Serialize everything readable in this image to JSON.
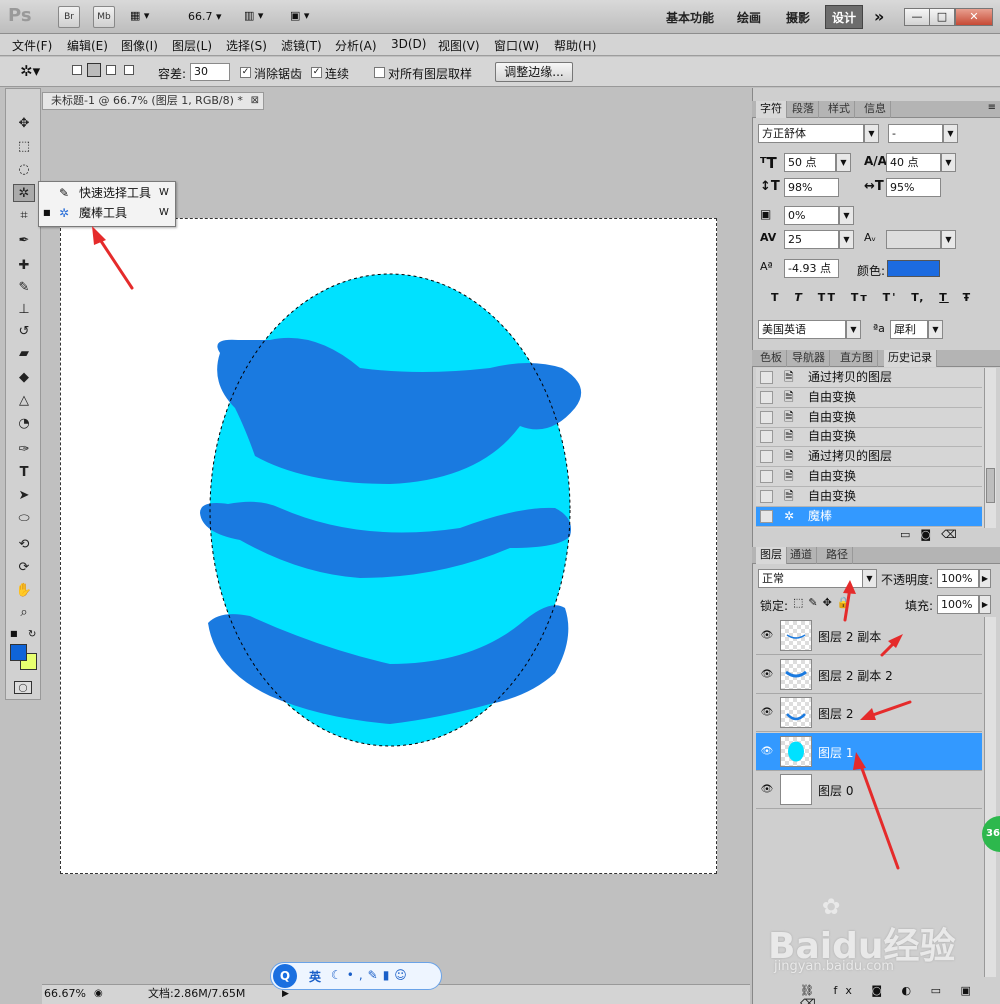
{
  "titlebar": {
    "app_logo": "Ps",
    "btn_bridge": "Br",
    "btn_minibridge": "Mb",
    "zoom": "66.7",
    "workspaces": [
      "基本功能",
      "绘画",
      "摄影"
    ],
    "active_workspace": "设计",
    "more": "»"
  },
  "menu": [
    "文件(F)",
    "编辑(E)",
    "图像(I)",
    "图层(L)",
    "选择(S)",
    "滤镜(T)",
    "分析(A)",
    "3D(D)",
    "视图(V)",
    "窗口(W)",
    "帮助(H)"
  ],
  "options": {
    "tolerance_label": "容差:",
    "tolerance_value": "30",
    "antialias_label": "消除锯齿",
    "contiguous_label": "连续",
    "sample_all_label": "对所有图层取样",
    "refine_edge": "调整边缘..."
  },
  "document": {
    "tab_title": "未标题-1 @ 66.7% (图层 1, RGB/8) *",
    "zoom_status": "66.67%",
    "doc_size": "文档:2.86M/7.65M"
  },
  "flyout": {
    "items": [
      {
        "label": "快速选择工具",
        "shortcut": "W"
      },
      {
        "label": "魔棒工具",
        "shortcut": "W"
      }
    ]
  },
  "character_panel": {
    "tabs": [
      "字符",
      "段落",
      "样式",
      "信息"
    ],
    "font_family": "方正舒体",
    "font_style": "-",
    "font_size": "50 点",
    "leading": "40 点",
    "vertical_scale": "98%",
    "horizontal_scale": "95%",
    "tsume": "0%",
    "tracking": "25",
    "baseline_shift": "-4.93 点",
    "color_label": "颜色:",
    "style_buttons": [
      "T",
      "T",
      "TT",
      "Tт",
      "T'",
      "T,",
      "T",
      "Ŧ"
    ],
    "language": "美国英语",
    "aa_icon": "ªa",
    "antialias": "犀利"
  },
  "history_panel": {
    "tabs": [
      "色板",
      "导航器",
      "直方图",
      "历史记录"
    ],
    "items": [
      "通过拷贝的图层",
      "自由变换",
      "自由变换",
      "自由变换",
      "通过拷贝的图层",
      "自由变换",
      "自由变换",
      "魔棒"
    ]
  },
  "layers_panel": {
    "tabs": [
      "图层",
      "通道",
      "路径"
    ],
    "blend_mode": "正常",
    "opacity_label": "不透明度:",
    "opacity": "100%",
    "lock_label": "锁定:",
    "fill_label": "填充:",
    "fill": "100%",
    "layers": [
      "图层 2 副本",
      "图层 2 副本 2",
      "图层 2",
      "图层 1",
      "图层 0"
    ]
  },
  "ime_bar": {
    "label": "英"
  },
  "watermark": {
    "brand": "Baidu经验",
    "url": "jingyan.baidu.com",
    "badge": "36"
  },
  "colors": {
    "egg_light": "#00e1ff",
    "egg_stripe": "#1a7ae0",
    "foreground": "#0f64d8",
    "background": "#e7ff70",
    "layer_selected": "#3399ff",
    "history_selected": "#3399ff",
    "text_color_swatch": "#1c6be0"
  }
}
